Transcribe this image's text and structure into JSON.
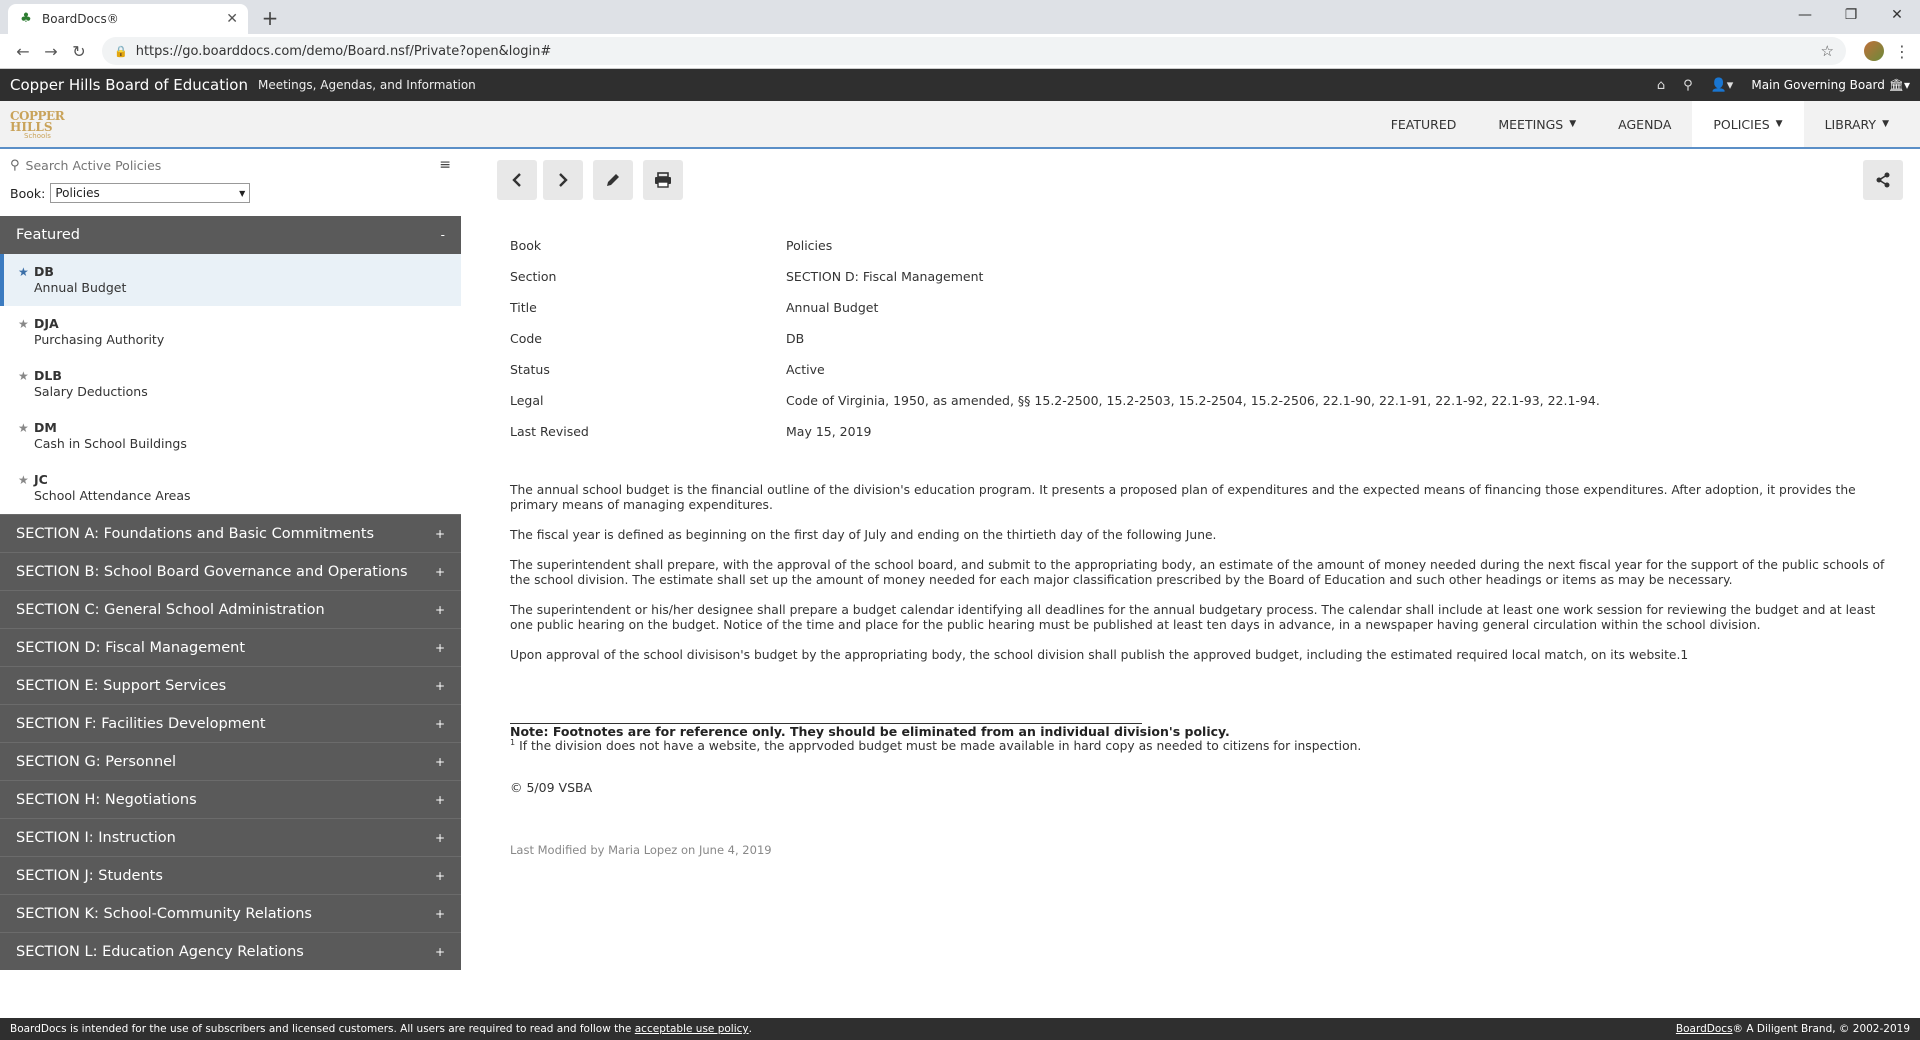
{
  "browser": {
    "tab_title": "BoardDocs®",
    "url": "https://go.boarddocs.com/demo/Board.nsf/Private?open&login#"
  },
  "header": {
    "org_name": "Copper Hills Board of Education",
    "tagline": "Meetings, Agendas, and Information",
    "board_label": "Main Governing Board"
  },
  "logo": {
    "line1": "COPPER",
    "line2": "HILLS",
    "line3": "Schools"
  },
  "nav": {
    "featured": "FEATURED",
    "meetings": "MEETINGS",
    "agenda": "AGENDA",
    "policies": "POLICIES",
    "library": "LIBRARY"
  },
  "sidebar": {
    "search_placeholder": "Search Active Policies",
    "book_label": "Book:",
    "book_value": "Policies",
    "featured_label": "Featured",
    "featured_toggle": "-",
    "featured_items": [
      {
        "code": "DB",
        "name": "Annual Budget"
      },
      {
        "code": "DJA",
        "name": "Purchasing Authority"
      },
      {
        "code": "DLB",
        "name": "Salary Deductions"
      },
      {
        "code": "DM",
        "name": "Cash in School Buildings"
      },
      {
        "code": "JC",
        "name": "School Attendance Areas"
      }
    ],
    "sections": [
      "SECTION A: Foundations and Basic Commitments",
      "SECTION B: School Board Governance and Operations",
      "SECTION C: General School Administration",
      "SECTION D: Fiscal Management",
      "SECTION E: Support Services",
      "SECTION F: Facilities Development",
      "SECTION G: Personnel",
      "SECTION H: Negotiations",
      "SECTION I: Instruction",
      "SECTION J: Students",
      "SECTION K: School-Community Relations",
      "SECTION L: Education Agency Relations"
    ],
    "section_toggle": "+"
  },
  "policy": {
    "meta": [
      {
        "key": "Book",
        "value": "Policies"
      },
      {
        "key": "Section",
        "value": "SECTION D: Fiscal Management"
      },
      {
        "key": "Title",
        "value": "Annual Budget"
      },
      {
        "key": "Code",
        "value": "DB"
      },
      {
        "key": "Status",
        "value": "Active"
      },
      {
        "key": "Legal",
        "value": "Code of Virginia, 1950, as amended, §§ 15.2-2500, 15.2-2503, 15.2-2504, 15.2-2506, 22.1-90, 22.1-91, 22.1-92, 22.1-93, 22.1-94."
      },
      {
        "key": "Last Revised",
        "value": "May 15, 2019"
      }
    ],
    "paragraphs": [
      "The annual school budget is the financial outline of the division's education program. It presents a proposed plan of expenditures and the expected means of financing those expenditures. After adoption, it provides the primary means of managing expenditures.",
      "The fiscal year is defined as beginning on the first day of July and ending on the thirtieth day of the following June.",
      "The superintendent shall prepare, with the approval of the school board, and submit to the appropriating body, an estimate of the amount of money needed during the next fiscal year for the support of the public schools of the school division. The estimate shall set up the amount of money needed for each major classification prescribed by the Board of Education and such other headings or items as may be necessary.",
      "The superintendent or his/her designee shall prepare a budget calendar identifying all deadlines for the annual budgetary process. The calendar shall include at least one work session for reviewing the budget and at least one public hearing on the budget. Notice of the time and place for the public hearing must be published at least ten days in advance, in a newspaper having general circulation within the school division.",
      "Upon approval of the school divisison's budget by the appropriating body, the school division shall publish the approved budget, including the estimated required local match, on its website.1"
    ],
    "footnote_note": "Note: Footnotes are for reference only. They should be eliminated from an individual division's policy.",
    "footnote_mark": "1",
    "footnote_text": "If the division does not have a website, the apprvoded budget must be made available in hard copy as needed to citizens for inspection.",
    "copyright": "© 5/09 VSBA",
    "last_modified": "Last Modified by Maria Lopez on June 4, 2019"
  },
  "footer": {
    "notice": "BoardDocs is intended for the use of subscribers and licensed customers. All users are required to read and follow the",
    "link": "acceptable use policy",
    "period": ".",
    "brand_link": "BoardDocs",
    "brand_rest": "® A Diligent Brand, © 2002-2019"
  },
  "icons": {
    "back": "chevron-left-icon",
    "forward": "chevron-right-icon",
    "edit": "pencil-icon",
    "print": "printer-icon",
    "share": "share-icon"
  }
}
